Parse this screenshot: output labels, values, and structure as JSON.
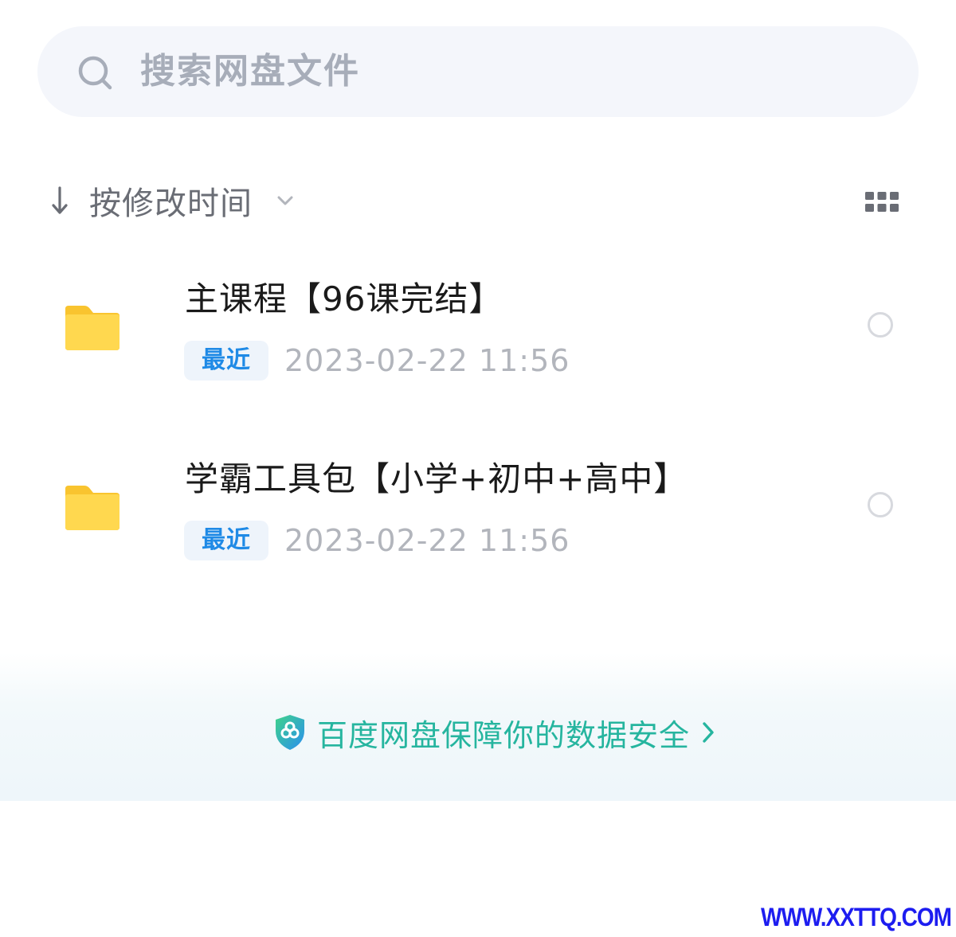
{
  "search": {
    "placeholder": "搜索网盘文件",
    "icon": "search-icon"
  },
  "sort": {
    "label": "按修改时间",
    "direction_icon": "arrow-down-icon",
    "dropdown_icon": "chevron-down-icon"
  },
  "view_toggle": {
    "icon": "grid-view-icon"
  },
  "files": [
    {
      "name": "主课程【96课完结】",
      "badge": "最近",
      "date": "2023-02-22  11:56",
      "icon": "folder-icon"
    },
    {
      "name": "学霸工具包【小学+初中+高中】",
      "badge": "最近",
      "date": "2023-02-22  11:56",
      "icon": "folder-icon"
    }
  ],
  "footer": {
    "security_text": "百度网盘保障你的数据安全",
    "shield_icon": "shield-icon",
    "chevron_icon": "chevron-right-icon"
  },
  "watermark": "WWW.XXTTQ.COM",
  "colors": {
    "accent_blue": "#1f8ae6",
    "security_green": "#26b59f",
    "folder_yellow": "#ffd54a",
    "watermark_blue": "#1d1df0"
  }
}
